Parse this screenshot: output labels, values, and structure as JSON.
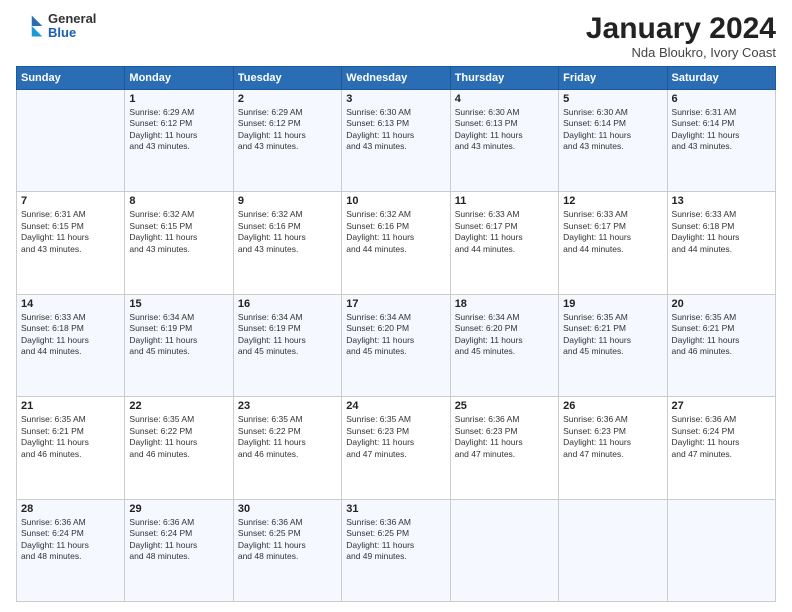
{
  "logo": {
    "general": "General",
    "blue": "Blue"
  },
  "title": "January 2024",
  "subtitle": "Nda Bloukro, Ivory Coast",
  "days": [
    "Sunday",
    "Monday",
    "Tuesday",
    "Wednesday",
    "Thursday",
    "Friday",
    "Saturday"
  ],
  "weeks": [
    [
      {
        "day": "",
        "info": ""
      },
      {
        "day": "1",
        "info": "Sunrise: 6:29 AM\nSunset: 6:12 PM\nDaylight: 11 hours\nand 43 minutes."
      },
      {
        "day": "2",
        "info": "Sunrise: 6:29 AM\nSunset: 6:12 PM\nDaylight: 11 hours\nand 43 minutes."
      },
      {
        "day": "3",
        "info": "Sunrise: 6:30 AM\nSunset: 6:13 PM\nDaylight: 11 hours\nand 43 minutes."
      },
      {
        "day": "4",
        "info": "Sunrise: 6:30 AM\nSunset: 6:13 PM\nDaylight: 11 hours\nand 43 minutes."
      },
      {
        "day": "5",
        "info": "Sunrise: 6:30 AM\nSunset: 6:14 PM\nDaylight: 11 hours\nand 43 minutes."
      },
      {
        "day": "6",
        "info": "Sunrise: 6:31 AM\nSunset: 6:14 PM\nDaylight: 11 hours\nand 43 minutes."
      }
    ],
    [
      {
        "day": "7",
        "info": "Sunrise: 6:31 AM\nSunset: 6:15 PM\nDaylight: 11 hours\nand 43 minutes."
      },
      {
        "day": "8",
        "info": "Sunrise: 6:32 AM\nSunset: 6:15 PM\nDaylight: 11 hours\nand 43 minutes."
      },
      {
        "day": "9",
        "info": "Sunrise: 6:32 AM\nSunset: 6:16 PM\nDaylight: 11 hours\nand 43 minutes."
      },
      {
        "day": "10",
        "info": "Sunrise: 6:32 AM\nSunset: 6:16 PM\nDaylight: 11 hours\nand 44 minutes."
      },
      {
        "day": "11",
        "info": "Sunrise: 6:33 AM\nSunset: 6:17 PM\nDaylight: 11 hours\nand 44 minutes."
      },
      {
        "day": "12",
        "info": "Sunrise: 6:33 AM\nSunset: 6:17 PM\nDaylight: 11 hours\nand 44 minutes."
      },
      {
        "day": "13",
        "info": "Sunrise: 6:33 AM\nSunset: 6:18 PM\nDaylight: 11 hours\nand 44 minutes."
      }
    ],
    [
      {
        "day": "14",
        "info": "Sunrise: 6:33 AM\nSunset: 6:18 PM\nDaylight: 11 hours\nand 44 minutes."
      },
      {
        "day": "15",
        "info": "Sunrise: 6:34 AM\nSunset: 6:19 PM\nDaylight: 11 hours\nand 45 minutes."
      },
      {
        "day": "16",
        "info": "Sunrise: 6:34 AM\nSunset: 6:19 PM\nDaylight: 11 hours\nand 45 minutes."
      },
      {
        "day": "17",
        "info": "Sunrise: 6:34 AM\nSunset: 6:20 PM\nDaylight: 11 hours\nand 45 minutes."
      },
      {
        "day": "18",
        "info": "Sunrise: 6:34 AM\nSunset: 6:20 PM\nDaylight: 11 hours\nand 45 minutes."
      },
      {
        "day": "19",
        "info": "Sunrise: 6:35 AM\nSunset: 6:21 PM\nDaylight: 11 hours\nand 45 minutes."
      },
      {
        "day": "20",
        "info": "Sunrise: 6:35 AM\nSunset: 6:21 PM\nDaylight: 11 hours\nand 46 minutes."
      }
    ],
    [
      {
        "day": "21",
        "info": "Sunrise: 6:35 AM\nSunset: 6:21 PM\nDaylight: 11 hours\nand 46 minutes."
      },
      {
        "day": "22",
        "info": "Sunrise: 6:35 AM\nSunset: 6:22 PM\nDaylight: 11 hours\nand 46 minutes."
      },
      {
        "day": "23",
        "info": "Sunrise: 6:35 AM\nSunset: 6:22 PM\nDaylight: 11 hours\nand 46 minutes."
      },
      {
        "day": "24",
        "info": "Sunrise: 6:35 AM\nSunset: 6:23 PM\nDaylight: 11 hours\nand 47 minutes."
      },
      {
        "day": "25",
        "info": "Sunrise: 6:36 AM\nSunset: 6:23 PM\nDaylight: 11 hours\nand 47 minutes."
      },
      {
        "day": "26",
        "info": "Sunrise: 6:36 AM\nSunset: 6:23 PM\nDaylight: 11 hours\nand 47 minutes."
      },
      {
        "day": "27",
        "info": "Sunrise: 6:36 AM\nSunset: 6:24 PM\nDaylight: 11 hours\nand 47 minutes."
      }
    ],
    [
      {
        "day": "28",
        "info": "Sunrise: 6:36 AM\nSunset: 6:24 PM\nDaylight: 11 hours\nand 48 minutes."
      },
      {
        "day": "29",
        "info": "Sunrise: 6:36 AM\nSunset: 6:24 PM\nDaylight: 11 hours\nand 48 minutes."
      },
      {
        "day": "30",
        "info": "Sunrise: 6:36 AM\nSunset: 6:25 PM\nDaylight: 11 hours\nand 48 minutes."
      },
      {
        "day": "31",
        "info": "Sunrise: 6:36 AM\nSunset: 6:25 PM\nDaylight: 11 hours\nand 49 minutes."
      },
      {
        "day": "",
        "info": ""
      },
      {
        "day": "",
        "info": ""
      },
      {
        "day": "",
        "info": ""
      }
    ]
  ]
}
